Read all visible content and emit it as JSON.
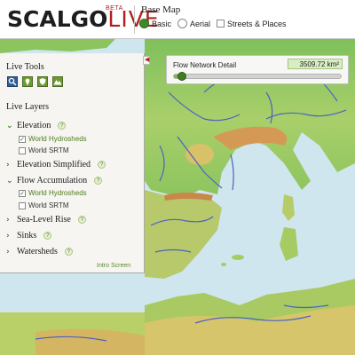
{
  "app": {
    "logo_primary": "SCALGO",
    "logo_secondary": "LIVE",
    "beta": "BETA"
  },
  "basemap": {
    "title": "Base Map",
    "options": [
      {
        "label": "Basic",
        "type": "radio",
        "selected": true
      },
      {
        "label": "Aerial",
        "type": "radio",
        "selected": false
      },
      {
        "label": "Streets & Places",
        "type": "checkbox",
        "checked": false
      }
    ]
  },
  "panel": {
    "tools_title": "Live Tools",
    "tools": [
      {
        "icon": "search-icon",
        "selected": true
      },
      {
        "icon": "pin-icon",
        "selected": false
      },
      {
        "icon": "shield-icon",
        "selected": false
      },
      {
        "icon": "terrain-icon",
        "selected": false
      }
    ],
    "layers_title": "Live Layers",
    "layers": [
      {
        "label": "Elevation",
        "expanded": true,
        "sub": [
          {
            "label": "World Hydrosheds",
            "checked": true
          },
          {
            "label": "World SRTM",
            "checked": false
          }
        ]
      },
      {
        "label": "Elevation Simplified",
        "expanded": false,
        "sub": []
      },
      {
        "label": "Flow Accumulation",
        "expanded": true,
        "sub": [
          {
            "label": "World Hydrosheds",
            "checked": true
          },
          {
            "label": "World SRTM",
            "checked": false
          }
        ]
      },
      {
        "label": "Sea-Level Rise",
        "expanded": false,
        "sub": []
      },
      {
        "label": "Sinks",
        "expanded": false,
        "sub": []
      },
      {
        "label": "Watersheds",
        "expanded": false,
        "sub": []
      }
    ],
    "help_glyph": "?",
    "intro_link": "Intro Screen"
  },
  "slider": {
    "label": "Flow Network Detail",
    "value": "3509.72 km²",
    "fraction": 0.05
  },
  "colors": {
    "accent": "#b0201f",
    "green": "#3f7e1f",
    "sea": "#cfe6ee",
    "land_low": "#8cc45e",
    "land_mid": "#d8c86a",
    "land_high": "#c58a4c",
    "river": "#4a62c4"
  }
}
